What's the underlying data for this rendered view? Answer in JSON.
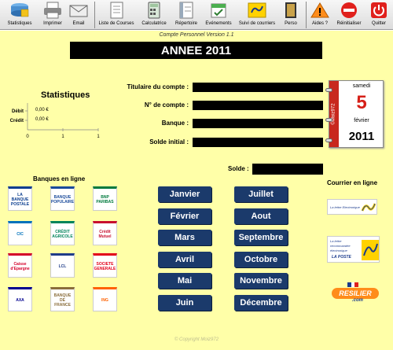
{
  "toolbar": {
    "items": [
      {
        "label": "Statistiques",
        "icon": "database-icon"
      },
      {
        "label": "Imprimer",
        "icon": "printer-icon"
      },
      {
        "label": "Email",
        "icon": "email-icon"
      },
      {
        "label": "Liste de Courses",
        "icon": "shopping-list-icon"
      },
      {
        "label": "Calculatrice",
        "icon": "calculator-icon"
      },
      {
        "label": "Répertoire",
        "icon": "directory-icon"
      },
      {
        "label": "Evénements",
        "icon": "events-icon"
      },
      {
        "label": "Suivi de courriers",
        "icon": "la-poste-icon"
      },
      {
        "label": "Perso",
        "icon": "perso-icon"
      },
      {
        "label": "Aides ?",
        "icon": "warning-icon"
      },
      {
        "label": "Réinitialiser",
        "icon": "reset-icon"
      },
      {
        "label": "Quitter",
        "icon": "power-icon"
      }
    ]
  },
  "header": {
    "subtitle": "Compte Personnel  Version 1.1",
    "year_title": "ANNEE 2011"
  },
  "stats": {
    "title": "Statistiques",
    "rows": [
      {
        "label": "Débit",
        "value": "0,00 €"
      },
      {
        "label": "Crédit",
        "value": "0,00 €"
      }
    ],
    "ticks": [
      "0",
      "1",
      "1"
    ]
  },
  "account": {
    "titulaire_label": "Titulaire du compte :",
    "numero_label": "N° de compte :",
    "banque_label": "Banque :",
    "solde_initial_label": "Solde initial :",
    "solde_label": "Solde :"
  },
  "calendar": {
    "weekday": "samedi",
    "day": "5",
    "month": "février",
    "year": "2011",
    "strip": "©Moiz972"
  },
  "banks": {
    "title": "Banques  en ligne",
    "logos": [
      {
        "name": "LA BANQUE POSTALE",
        "color": "#0a3d8f"
      },
      {
        "name": "BANQUE POPULAIRE",
        "color": "#1a4a9a"
      },
      {
        "name": "BNP PARIBAS",
        "color": "#007a3d"
      },
      {
        "name": "CIC",
        "color": "#0072bc"
      },
      {
        "name": "CRÉDIT AGRICOLE",
        "color": "#00845a"
      },
      {
        "name": "Crédit Mutuel",
        "color": "#c8102e"
      },
      {
        "name": "Caisse d'Epargne",
        "color": "#d4002a"
      },
      {
        "name": "LCL",
        "color": "#1f3c88"
      },
      {
        "name": "SOCIETE GENERALE",
        "color": "#e2001a"
      },
      {
        "name": "AXA",
        "color": "#00008f"
      },
      {
        "name": "BANQUE DE FRANCE",
        "color": "#8a6d3b"
      },
      {
        "name": "ING",
        "color": "#ff6200"
      }
    ]
  },
  "months": {
    "left": [
      "Janvier",
      "Février",
      "Mars",
      "Avril",
      "Mai",
      "Juin"
    ],
    "right": [
      "Juillet",
      "Aout",
      "Septembre",
      "Octobre",
      "Novembre",
      "Décembre"
    ]
  },
  "courrier": {
    "title": "Courrier en ligne",
    "lettre_electronique": "La lettre Electronique",
    "lettre_recommandee": "La lettre recommandée électronique",
    "la_poste": "LA POSTE",
    "resilier": "RESILIER",
    "resilier_sub": ".com"
  },
  "footer": {
    "copyright": "© Copyright  Moiz972"
  },
  "colors": {
    "panel_bg": "#ffffa8",
    "month_button": "#1b3a6b",
    "calendar_red": "#c8281e"
  }
}
